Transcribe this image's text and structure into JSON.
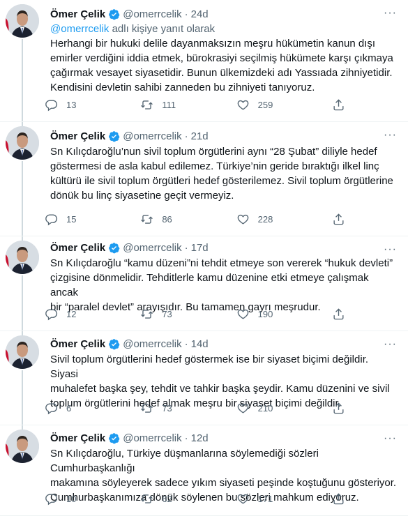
{
  "accent_color": "#1d9bf0",
  "icons": {
    "reply": "reply-icon",
    "retweet": "retweet-icon",
    "like": "heart-icon",
    "share": "share-icon",
    "verified": "verified-badge-icon",
    "more": "more-icon"
  },
  "tweets": [
    {
      "name": "Ömer Çelik",
      "handle": "@omerrcelik",
      "dot": "·",
      "time": "24d",
      "more": "···",
      "reply_mention": "@omerrcelik",
      "reply_suffix": " adlı kişiye yanıt olarak",
      "lines": [
        "Herhangi bir hukuki delile dayanmaksızın meşru hükümetin kanun dışı",
        "emirler verdiğini iddia etmek, bürokrasiyi seçilmiş hükümete karşı çıkmaya",
        "çağırmak vesayet siyasetidir. Bunun ülkemizdeki adı Yassıada zihniyetidir.",
        "Kendisini devletin sahibi zanneden bu zihniyeti tanıyoruz."
      ],
      "replies": "13",
      "retweets": "111",
      "likes": "259"
    },
    {
      "name": "Ömer Çelik",
      "handle": "@omerrcelik",
      "dot": "·",
      "time": "21d",
      "more": "···",
      "lines": [
        "Sn Kılıçdaroğlu’nun sivil toplum örgütlerini aynı “28 Şubat” diliyle hedef",
        "göstermesi de asla kabul edilemez. Türkiye’nin geride bıraktığı ilkel linç",
        "kültürü ile sivil toplum örgütleri hedef gösterilemez. Sivil toplum örgütlerine",
        "dönük bu linç siyasetine geçit vermeyiz."
      ],
      "replies": "15",
      "retweets": "86",
      "likes": "228"
    },
    {
      "name": "Ömer Çelik",
      "handle": "@omerrcelik",
      "dot": "·",
      "time": "17d",
      "more": "···",
      "lines": [
        "Sn Kılıçdaroğlu “kamu düzeni”ni tehdit etmeye son vererek “hukuk devleti”",
        "çizgisine dönmelidir. Tehditlerle kamu düzenine etki etmeye çalışmak ancak",
        "bir “paralel devlet” arayışıdır. Bu tamamen gayrı meşrudur."
      ],
      "replies": "12",
      "retweets": "73",
      "likes": "190"
    },
    {
      "name": "Ömer Çelik",
      "handle": "@omerrcelik",
      "dot": "·",
      "time": "14d",
      "more": "···",
      "lines": [
        "Sivil toplum örgütlerini hedef göstermek ise bir siyaset biçimi değildir. Siyasi",
        "muhalefet başka şey, tehdit ve tahkir başka şeydir. Kamu düzenini ve sivil",
        "toplum örgütlerini hedef almak meşru bir siyaset biçimi değildir."
      ],
      "replies": "6",
      "retweets": "73",
      "likes": "210"
    },
    {
      "name": "Ömer Çelik",
      "handle": "@omerrcelik",
      "dot": "·",
      "time": "12d",
      "more": "···",
      "lines": [
        "Sn Kılıçdaroğlu, Türkiye düşmanlarına söylemediği sözleri Cumhurbaşkanlığı",
        "makamına söyleyerek sadece yıkım siyaseti peşinde koştuğunu gösteriyor.",
        "Cumhurbaşkanımıza dönük söylenen bu sözleri mahkum ediyoruz."
      ],
      "replies": "10",
      "retweets": "62",
      "likes": "171"
    }
  ]
}
